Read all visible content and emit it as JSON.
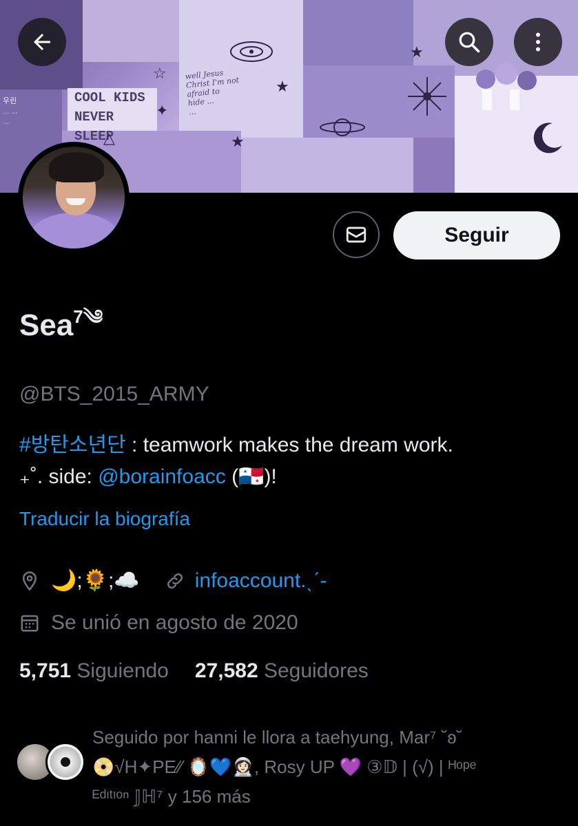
{
  "header": {
    "back_icon": "arrow-left-icon",
    "search_icon": "search-icon",
    "more_icon": "more-vertical-icon",
    "banner_text_main": "COOL KIDS\nNEVER SLEEP",
    "banner_text_hand": "well Jesus\nChrist I'm not\nafraid to\nhide ...\n...",
    "banner_text_kor": "우린\n... ...\n...",
    "banner_colors": [
      "#6b5a9c",
      "#9b88c9",
      "#c7b8e6",
      "#ece6f7"
    ]
  },
  "actions": {
    "message_icon": "envelope-icon",
    "follow_label": "Seguir"
  },
  "profile": {
    "name": "Sea",
    "name_sup": "7",
    "name_emoji": "༄",
    "handle": "@BTS_2015_ARMY",
    "bio_hashtag": "#방탄소년단",
    "bio_line1_rest": " : teamwork makes the dream work.",
    "bio_line2_prefix": "₊˚. side: ",
    "bio_mention": "@borainfoacc",
    "bio_line2_suffix": " (🇵🇦)!",
    "translate_label": "Traducir la biografía"
  },
  "meta": {
    "location_icon": "location-pin-icon",
    "location": "🌙;🌻;☁️",
    "link_icon": "link-icon",
    "website": "infoaccount.ˎˊ-",
    "calendar_icon": "calendar-icon",
    "joined": "Se unió en agosto de 2020"
  },
  "stats": {
    "following_count": "5,751",
    "following_label": "Siguiendo",
    "followers_count": "27,582",
    "followers_label": "Seguidores"
  },
  "followed_by": {
    "text_line1": "Seguido por hanni le llora a taehyung, Mar⁷ ˘ʚ˘",
    "text_line2": "📀√H✦PE⁄⁄ 🪞💙👩🏻‍🚀, Rosy UP 💜 ③𝔻 | (√) | ᴴᵒᵖᵉ",
    "text_line3": "ᴱᵈᶦᵗᶦᵒⁿ 𝕁ℍ⁷ y 156 más"
  },
  "colors": {
    "accent": "#1d9bf0",
    "muted": "#71767b",
    "text": "#e7e9ea",
    "background": "#000000"
  }
}
